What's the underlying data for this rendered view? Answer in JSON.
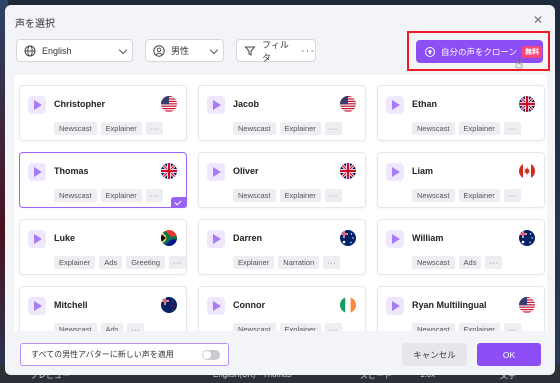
{
  "dialog": {
    "title": "声を選択",
    "language_value": "English",
    "gender_value": "男性",
    "filter_label": "フィルタ",
    "filter_more": "···",
    "clone_button_label": "自分の声をクローン",
    "clone_badge": "無料",
    "apply_all_label": "すべての男性アバターに新しい声を適用",
    "cancel_label": "キャンセル",
    "ok_label": "OK",
    "accent_color": "#8d4ff5",
    "highlight_color": "#ee1b24"
  },
  "voices": [
    {
      "name": "Christopher",
      "flag": "us-flag-icon",
      "tags": [
        "Newscast",
        "Explainer"
      ],
      "selected": false
    },
    {
      "name": "Jacob",
      "flag": "us-flag-icon",
      "tags": [
        "Newscast",
        "Explainer"
      ],
      "selected": false
    },
    {
      "name": "Ethan",
      "flag": "uk-flag-icon",
      "tags": [
        "Newscast",
        "Explainer"
      ],
      "selected": false
    },
    {
      "name": "Thomas",
      "flag": "uk-flag-icon",
      "tags": [
        "Newscast",
        "Explainer"
      ],
      "selected": true
    },
    {
      "name": "Oliver",
      "flag": "uk-flag-icon",
      "tags": [
        "Newscast",
        "Explainer"
      ],
      "selected": false
    },
    {
      "name": "Liam",
      "flag": "canada-flag-icon",
      "tags": [
        "Newscast",
        "Explainer"
      ],
      "selected": false
    },
    {
      "name": "Luke",
      "flag": "south-africa-flag-icon",
      "tags": [
        "Explainer",
        "Ads",
        "Greeting"
      ],
      "selected": false
    },
    {
      "name": "Darren",
      "flag": "australia-flag-icon",
      "tags": [
        "Explainer",
        "Narration"
      ],
      "selected": false
    },
    {
      "name": "William",
      "flag": "australia-flag-icon",
      "tags": [
        "Newscast",
        "Ads"
      ],
      "selected": false
    },
    {
      "name": "Mitchell",
      "flag": "new-zealand-flag-icon",
      "tags": [
        "Newscast",
        "Ads"
      ],
      "selected": false
    },
    {
      "name": "Connor",
      "flag": "ireland-flag-icon",
      "tags": [
        "Newscast",
        "Explainer"
      ],
      "selected": false
    },
    {
      "name": "Ryan Multilingual",
      "flag": "us-flag-icon",
      "tags": [
        "Newscast",
        "Explainer"
      ],
      "selected": false
    }
  ],
  "more_tags_label": "···",
  "background": {
    "bottom_left": "プレビュー",
    "bottom_mid": "English(UK) - Thomas",
    "bottom_speed": "スピード",
    "bottom_value": "1.0x",
    "bottom_right": "文字"
  }
}
